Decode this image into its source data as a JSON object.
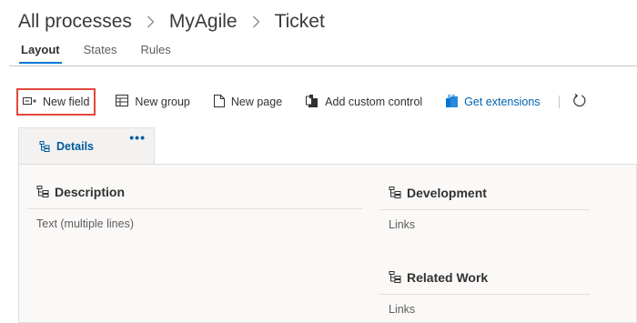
{
  "breadcrumb": {
    "items": [
      "All processes",
      "MyAgile",
      "Ticket"
    ]
  },
  "tabs": [
    {
      "label": "Layout",
      "active": true
    },
    {
      "label": "States",
      "active": false
    },
    {
      "label": "Rules",
      "active": false
    }
  ],
  "toolbar": {
    "new_field": "New field",
    "new_group": "New group",
    "new_page": "New page",
    "add_custom_control": "Add custom control",
    "get_extensions": "Get extensions"
  },
  "page_tab": {
    "label": "Details",
    "more": "•••"
  },
  "groups": {
    "description": {
      "title": "Description",
      "field": "Text (multiple lines)"
    },
    "development": {
      "title": "Development",
      "field": "Links"
    },
    "related_work": {
      "title": "Related Work",
      "field": "Links"
    }
  },
  "colors": {
    "accent": "#0078d4",
    "highlight_border": "#e0483b",
    "link": "#0063b1"
  }
}
